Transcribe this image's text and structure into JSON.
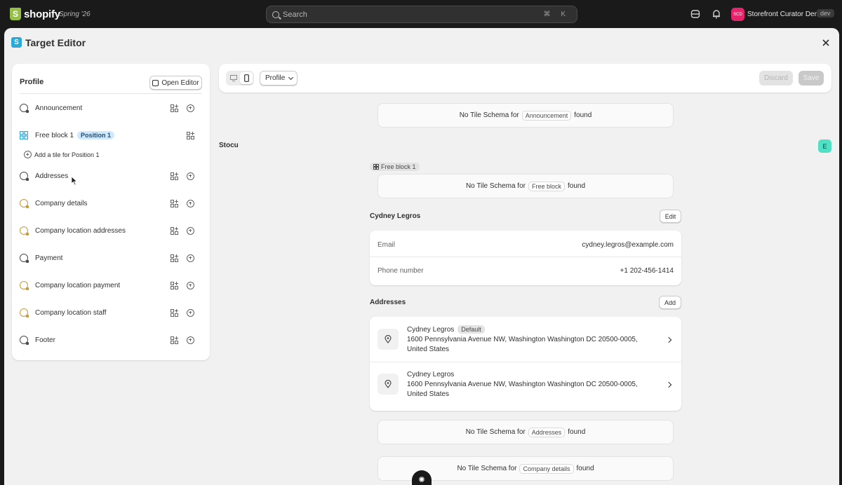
{
  "topbar": {
    "brand": "shopify",
    "edition": "Spring '26",
    "search_placeholder": "Search",
    "shortcut": "⌘ K",
    "store_initials": "SCD",
    "store_name": "Storefront Curator Demo",
    "store_tag": "dev"
  },
  "modal": {
    "icon_letter": "S",
    "title": "Target Editor"
  },
  "left_panel": {
    "title": "Profile",
    "open_editor_label": "Open Editor",
    "add_tile_label": "Add a tile for Position 1",
    "items": [
      {
        "label": "Announcement"
      },
      {
        "label": "Free block 1",
        "badge": "Position 1"
      },
      {
        "label": "Addresses"
      },
      {
        "label": "Company details"
      },
      {
        "label": "Company location addresses"
      },
      {
        "label": "Payment"
      },
      {
        "label": "Company location payment"
      },
      {
        "label": "Company location staff"
      },
      {
        "label": "Footer"
      }
    ]
  },
  "toolbar": {
    "view_select": "Profile",
    "discard_label": "Discard",
    "save_label": "Save"
  },
  "content": {
    "no_schema_prefix": "No Tile Schema for",
    "no_schema_suffix": "found",
    "schema_announcement": "Announcement",
    "schema_free_block": "Free block",
    "schema_addresses": "Addresses",
    "schema_company_details": "Company details",
    "section_label": "Stocu",
    "editor_avatar": "E",
    "free_block_chip": "Free block 1",
    "customer": {
      "name": "Cydney Legros",
      "edit_label": "Edit",
      "email_label": "Email",
      "email_value": "cydney.legros@example.com",
      "phone_label": "Phone number",
      "phone_value": "+1 202-456-1414"
    },
    "addresses": {
      "title": "Addresses",
      "add_label": "Add",
      "items": [
        {
          "name": "Cydney Legros",
          "badge": "Default",
          "line": "1600 Pennsylvania Avenue NW, Washington Washington DC 20500-0005, United States"
        },
        {
          "name": "Cydney Legros",
          "line": "1600 Pennsylvania Avenue NW, Washington Washington DC 20500-0005, United States"
        }
      ]
    }
  }
}
